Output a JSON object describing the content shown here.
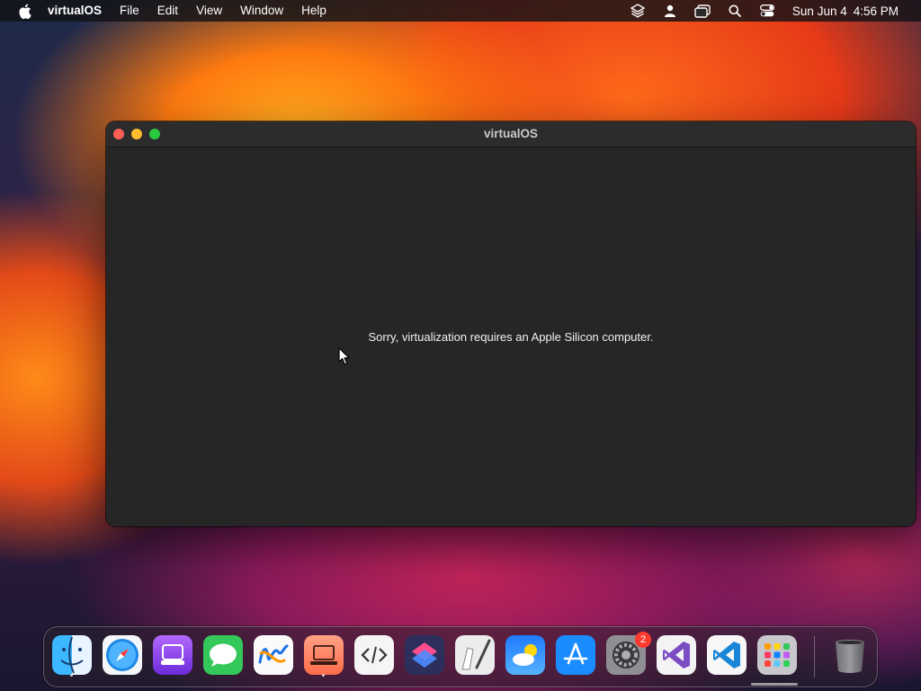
{
  "menubar": {
    "app_name": "virtualOS",
    "items": [
      "File",
      "Edit",
      "View",
      "Window",
      "Help"
    ],
    "status_icons": [
      "layers-icon",
      "user-icon",
      "screen-mirror-icon",
      "search-icon",
      "control-center-icon"
    ],
    "date": "Sun Jun 4",
    "time": "4:56 PM"
  },
  "window": {
    "title": "virtualOS",
    "message": "Sorry, virtualization requires an Apple Silicon computer."
  },
  "dock": {
    "apps": [
      "Finder",
      "Safari",
      "Podcasts",
      "Messages",
      "Freeform",
      "Remote Desktop",
      "Script Editor",
      "Shortcuts",
      "Script Draw",
      "Weather",
      "App Store",
      "System Settings",
      "Visual Studio",
      "Visual Studio Code",
      "Launchpad",
      "Trash"
    ],
    "settings_badge": "2"
  },
  "colors": {
    "close": "#ff5f57",
    "minimize": "#febc2e",
    "maximize": "#28c840",
    "badge": "#ff3b30"
  }
}
